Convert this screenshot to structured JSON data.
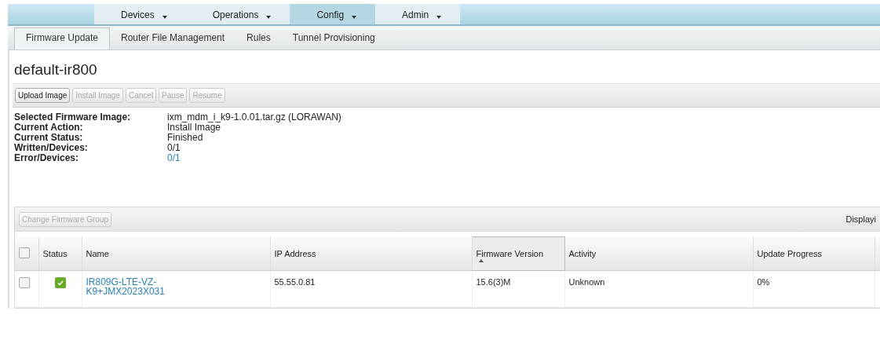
{
  "menu": [
    {
      "label": "Devices",
      "selected": false
    },
    {
      "label": "Operations",
      "selected": false
    },
    {
      "label": "Config",
      "selected": true
    },
    {
      "label": "Admin",
      "selected": false
    }
  ],
  "tabs": [
    {
      "label": "Firmware Update",
      "selected": true
    },
    {
      "label": "Router File Management",
      "selected": false
    },
    {
      "label": "Rules",
      "selected": false
    },
    {
      "label": "Tunnel Provisioning",
      "selected": false
    }
  ],
  "title": "default-ir800",
  "toolbar": [
    {
      "label": "Upload Image",
      "disabled": false
    },
    {
      "label": "Install Image",
      "disabled": true
    },
    {
      "label": "Cancel",
      "disabled": true
    },
    {
      "label": "Pause",
      "disabled": true
    },
    {
      "label": "Resume",
      "disabled": true
    }
  ],
  "details": [
    {
      "label": "Selected Firmware Image:",
      "value": "ixm_mdm_i_k9-1.0.01.tar.gz (LORAWAN)",
      "link": false
    },
    {
      "label": "Current Action:",
      "value": "Install Image",
      "link": false
    },
    {
      "label": "Current Status:",
      "value": "Finished",
      "link": false
    },
    {
      "label": "Written/Devices:",
      "value": "0/1",
      "link": false
    },
    {
      "label": "Error/Devices:",
      "value": "0/1",
      "link": true
    }
  ],
  "grid": {
    "button": {
      "label": "Change Firmware Group",
      "disabled": true
    },
    "paging": "Displayi",
    "header_checked": false,
    "columns": [
      {
        "label": "Status",
        "sorted": false
      },
      {
        "label": "Name",
        "sorted": false
      },
      {
        "label": "IP Address",
        "sorted": false
      },
      {
        "label": "Firmware Version",
        "sorted": true
      },
      {
        "label": "Activity",
        "sorted": false
      },
      {
        "label": "Update Progress",
        "sorted": false
      }
    ],
    "rows": [
      {
        "checked": false,
        "status_ok": true,
        "name": "IR809G-LTE-VZ-K9+JMX2023X031",
        "ip": "55.55.0.81",
        "firmware": "15.6(3)M",
        "activity": "Unknown",
        "progress": "0%"
      }
    ]
  }
}
